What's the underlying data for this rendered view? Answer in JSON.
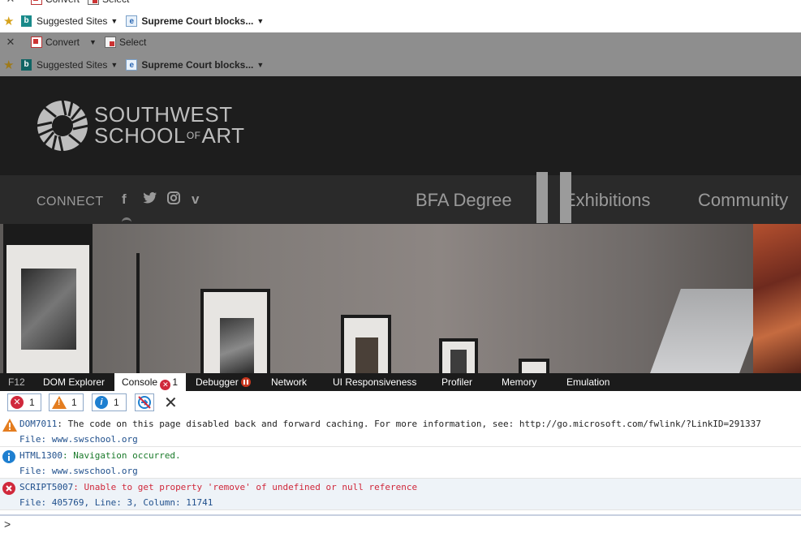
{
  "browser": {
    "convert_label": "Convert",
    "select_label": "Select",
    "favorites": [
      {
        "label": "Suggested Sites",
        "icon": "bing-icon"
      },
      {
        "label": "Supreme Court blocks...",
        "icon": "ie-page-icon"
      }
    ]
  },
  "site": {
    "logo_line1": "SOUTHWEST",
    "logo_line2_a": "SCHOOL",
    "logo_line2_small": "OF",
    "logo_line2_b": "ART",
    "connect_label": "CONNECT",
    "social_icons": [
      "facebook-icon",
      "twitter-icon",
      "instagram-icon",
      "vimeo-icon"
    ],
    "nav": [
      "BFA Degree",
      "Exhibitions",
      "Community"
    ]
  },
  "devtools": {
    "f12_label": "F12",
    "tabs": {
      "dom": "DOM Explorer",
      "console": "Console",
      "console_errors": "1",
      "debugger": "Debugger",
      "network": "Network",
      "ui": "UI Responsiveness",
      "profiler": "Profiler",
      "memory": "Memory",
      "emulation": "Emulation"
    },
    "filters": {
      "errors": "1",
      "warnings": "1",
      "info": "1"
    },
    "messages": [
      {
        "level": "warning",
        "code": "DOM7011",
        "text": ": The code on this page disabled back and forward caching. For more information, see: http://go.microsoft.com/fwlink/?LinkID=291337",
        "source": "File: www.swschool.org"
      },
      {
        "level": "info",
        "code": "HTML1300",
        "text": ": Navigation occurred.",
        "source": "File: www.swschool.org"
      },
      {
        "level": "error",
        "code": "SCRIPT5007",
        "text": ": Unable to get property 'remove' of undefined or null reference",
        "source": "File: 405769, Line: 3, Column: 11741"
      }
    ],
    "prompt": ">"
  },
  "colors": {
    "error": "#d0283b",
    "warning": "#e47d1f",
    "info": "#1e7fd0",
    "tab_bar": "#1b1b1b"
  }
}
